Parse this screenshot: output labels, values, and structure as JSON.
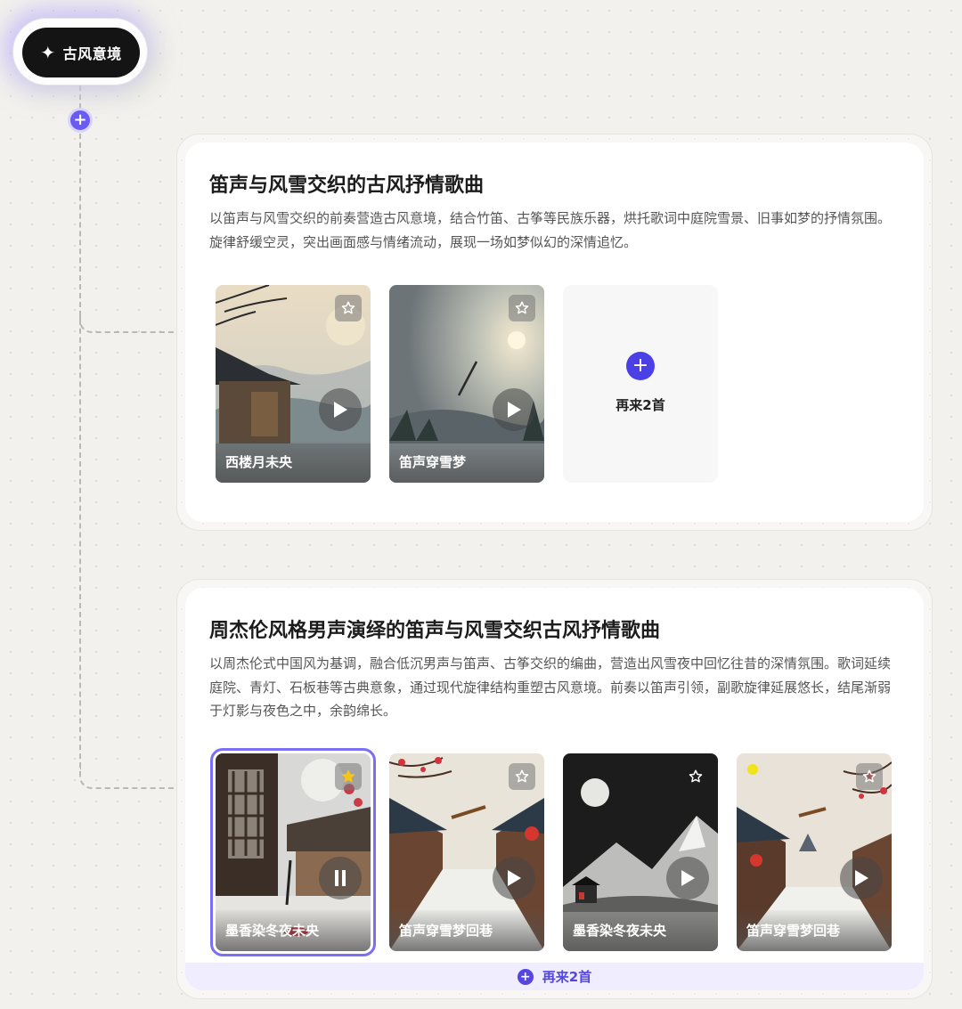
{
  "root": {
    "label": "古风意境",
    "icon": "sparkle-icon"
  },
  "sections": [
    {
      "title": "笛声与风雪交织的古风抒情歌曲",
      "description": "以笛声与风雪交织的前奏营造古风意境，结合竹笛、古筝等民族乐器，烘托歌词中庭院雪景、旧事如梦的抒情氛围。旋律舒缓空灵，突出画面感与情绪流动，展现一场如梦似幻的深情追忆。",
      "songs": [
        {
          "title": "西楼月未央",
          "favorited": false,
          "state": "paused"
        },
        {
          "title": "笛声穿雪梦",
          "favorited": false,
          "state": "paused"
        }
      ],
      "more_label": "再来2首"
    },
    {
      "title": "周杰伦风格男声演绎的笛声与风雪交织古风抒情歌曲",
      "description": "以周杰伦式中国风为基调，融合低沉男声与笛声、古筝交织的编曲，营造出风雪夜中回忆往昔的深情氛围。歌词延续庭院、青灯、石板巷等古典意象，通过现代旋律结构重塑古风意境。前奏以笛声引领，副歌旋律延展悠长，结尾渐弱于灯影与夜色之中，余韵绵长。",
      "songs": [
        {
          "title": "墨香染冬夜未央",
          "favorited": true,
          "state": "playing"
        },
        {
          "title": "笛声穿雪梦回巷",
          "favorited": false,
          "state": "paused"
        },
        {
          "title": "墨香染冬夜未央",
          "favorited": false,
          "state": "paused"
        },
        {
          "title": "笛声穿雪梦回巷",
          "favorited": false,
          "state": "paused"
        }
      ],
      "more_label": "再来2首"
    }
  ],
  "colors": {
    "accent": "#5546e0",
    "favorite": "#f5c518",
    "root_chip": "#141414"
  }
}
